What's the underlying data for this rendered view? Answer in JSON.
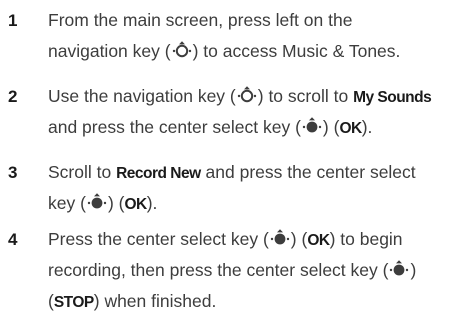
{
  "steps": [
    {
      "number": "1",
      "line1_a": "From the main screen, press left on the",
      "line2_a": "navigation key (",
      "line2_b": ") to access Music & Tones."
    },
    {
      "number": "2",
      "line1_a": "Use the navigation key (",
      "line1_b": ") to scroll to ",
      "line1_bold": "My Sounds",
      "line2_a": "and press the center select key (",
      "line2_b": ") (",
      "line2_bold": "OK",
      "line2_c": ")."
    },
    {
      "number": "3",
      "line1_a": "Scroll to ",
      "line1_bold": "Record New",
      "line1_b": " and press the center select",
      "line2_a": "key (",
      "line2_b": ") (",
      "line2_bold": "OK",
      "line2_c": ")."
    },
    {
      "number": "4",
      "line1_a": "Press the center select key (",
      "line1_b": ") (",
      "line1_bold": "OK",
      "line1_c": ") to begin",
      "line2_a": "recording, then press the center select key (",
      "line2_b": ")",
      "line3_a": "(",
      "line3_bold": "STOP",
      "line3_b": ") when finished."
    }
  ],
  "icons": {
    "nav_key": "navigation-key-icon",
    "select_key": "center-select-key-icon"
  },
  "colors": {
    "text": "#3d3d3d",
    "number": "#1a1a1a"
  }
}
